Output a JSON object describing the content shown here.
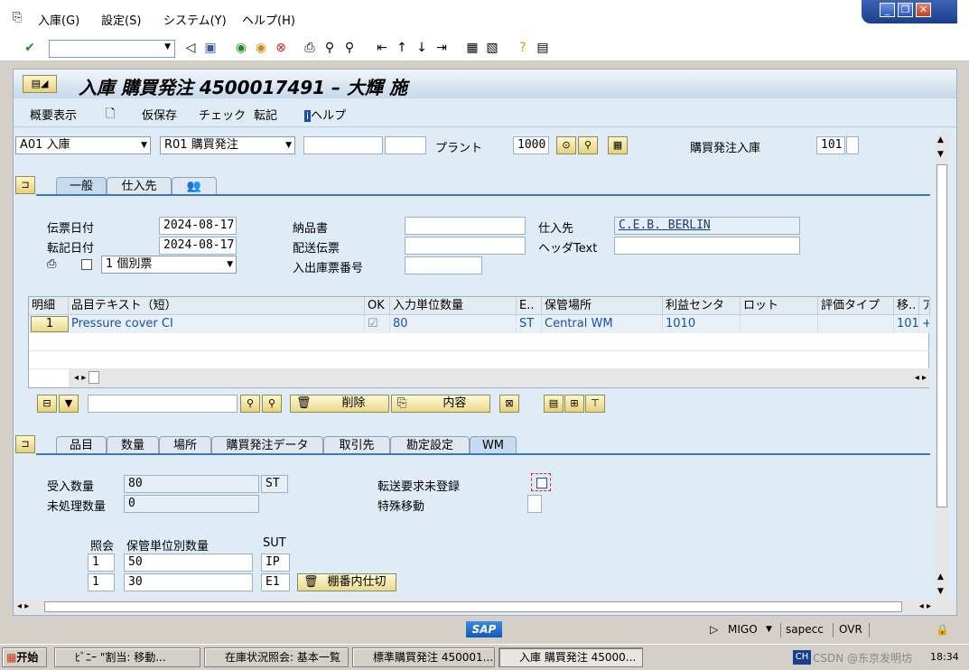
{
  "menu": {
    "items": [
      "入庫(G)",
      "設定(S)",
      "システム(Y)",
      "ヘルプ(H)"
    ]
  },
  "window_controls": {
    "minimize": "_",
    "restore": "❐",
    "close": "✕"
  },
  "title": "入庫 購買発注 4500017491 – 大輝 施",
  "app_toolbar": {
    "overview": "概要表示",
    "hold": "仮保存",
    "check": "チェック",
    "post": "転記",
    "help": "ヘルプ"
  },
  "header": {
    "action": "A01 入庫",
    "reference": "R01 購買発注",
    "plant_label": "プラント",
    "plant_value": "1000",
    "movement_label": "購買発注入庫",
    "movement_type": "101"
  },
  "top_tabs": [
    "一般",
    "仕入先",
    "👥"
  ],
  "general": {
    "doc_date_label": "伝票日付",
    "doc_date": "2024-08-17",
    "post_date_label": "転記日付",
    "post_date": "2024-08-17",
    "delivery_note_label": "納品書",
    "bill_lading_label": "配送伝票",
    "gr_slip_label": "入出庫票番号",
    "vendor_label": "仕入先",
    "vendor_value": "C.E.B. BERLIN",
    "header_text_label": "ヘッダText",
    "print_option": "1 個別票"
  },
  "items_table": {
    "headers": [
      "明細",
      "品目テキスト（短）",
      "OK",
      "入力単位数量",
      "E..",
      "保管場所",
      "利益センタ",
      "ロット",
      "評価タイプ",
      "移..",
      "ア"
    ],
    "rows": [
      {
        "line": "1",
        "text": "Pressure cover CI",
        "qty": "80",
        "unit": "ST",
        "sloc": "Central WM",
        "profit_center": "1010",
        "batch": "",
        "valtype": "",
        "mvt": "101",
        "extra": "+"
      }
    ]
  },
  "item_buttons": {
    "delete": "削除",
    "contents": "内容"
  },
  "detail_tabs": [
    "品目",
    "数量",
    "場所",
    "購買発注データ",
    "取引先",
    "勘定設定",
    "WM"
  ],
  "wm": {
    "gr_qty_label": "受入数量",
    "gr_qty": "80",
    "gr_unit": "ST",
    "open_qty_label": "未処理数量",
    "open_qty": "0",
    "no_to_label": "転送要求未登録",
    "special_mvt_label": "特殊移動",
    "table_headers": [
      "照会",
      "保管単位別数量",
      "SUT"
    ],
    "rows": [
      {
        "count": "1",
        "qty": "50",
        "sut": "IP"
      },
      {
        "count": "1",
        "qty": "30",
        "sut": "E1"
      }
    ],
    "putaway_button": "棚番内仕切"
  },
  "status_bar": {
    "logo": "SAP",
    "transaction": "MIGO",
    "server": "sapecc",
    "mode": "OVR"
  },
  "taskbar": {
    "start": "开始",
    "tasks": [
      "ﾋﾞﾆｰ \"割当: 移動...",
      "在庫状況照会: 基本一覧",
      "標準購買発注 450001...",
      "入庫 購買発注 45000..."
    ],
    "tray_text": "CSDN @东京发明坊",
    "clock": "18:34"
  }
}
